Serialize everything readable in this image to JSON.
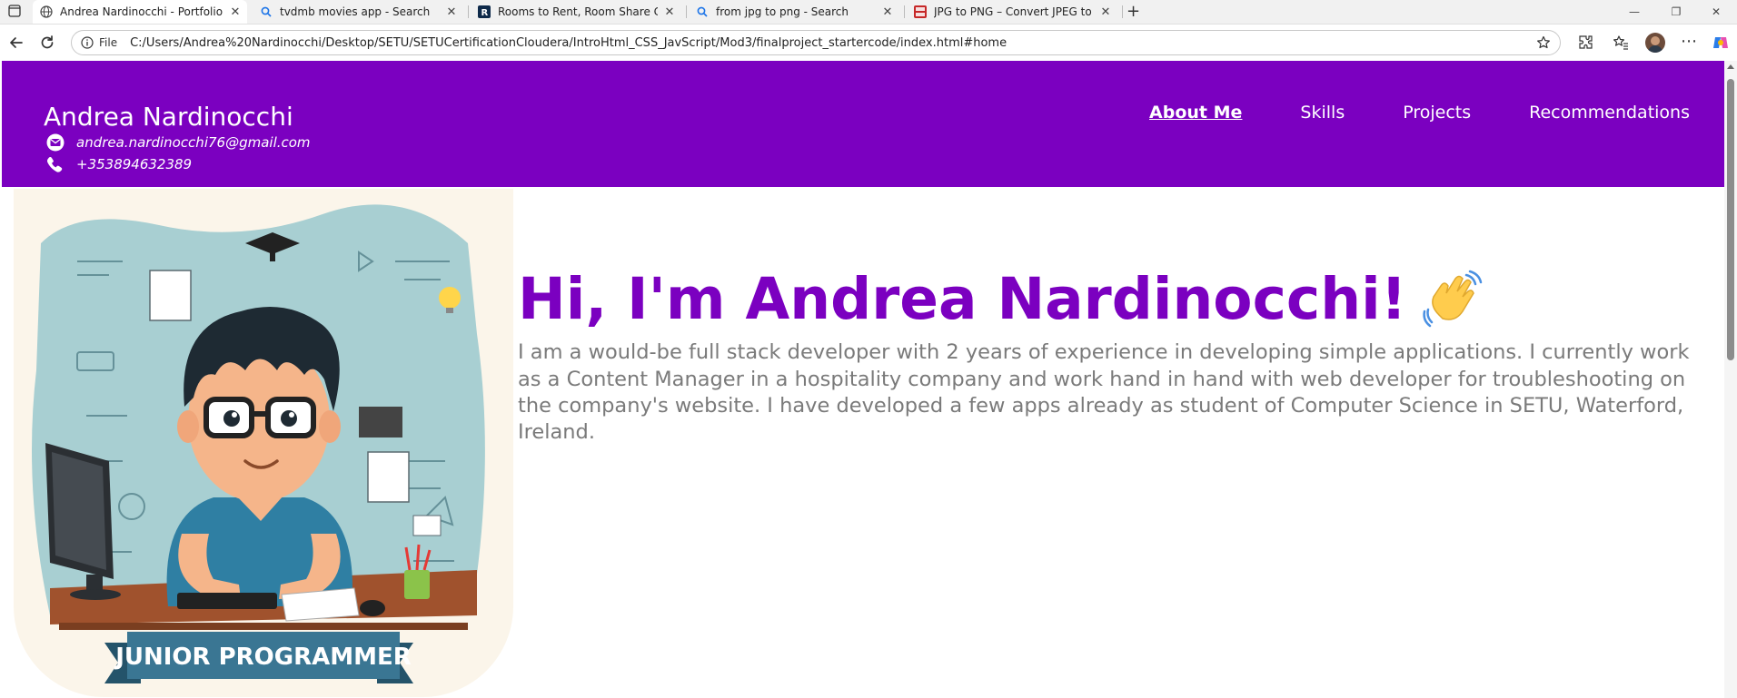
{
  "browser": {
    "tabs": [
      {
        "title": "Andrea Nardinocchi - Portfolio",
        "favicon": "globe-icon"
      },
      {
        "title": "tvdmb movies app - Search",
        "favicon": "search-icon"
      },
      {
        "title": "Rooms to Rent, Room Share Cork",
        "favicon": "r-logo-icon"
      },
      {
        "title": "from jpg to png - Search",
        "favicon": "search-icon"
      },
      {
        "title": "JPG to PNG – Convert JPEG to PN",
        "favicon": "jpg-png-icon"
      }
    ],
    "address": {
      "scheme": "File",
      "url": "C:/Users/Andrea%20Nardinocchi/Desktop/SETU/SETUCertificationCloudera/IntroHtml_CSS_JavScript/Mod3/finalproject_startercode/index.html#home"
    }
  },
  "site": {
    "name": "Andrea Nardinocchi",
    "email": "andrea.nardinocchi76@gmail.com",
    "phone": "+353894632389",
    "nav": [
      "About Me",
      "Skills",
      "Projects",
      "Recommendations"
    ],
    "active_nav": "About Me"
  },
  "hero": {
    "title": "Hi, I'm Andrea Nardinocchi!",
    "bio": "I am a would-be full stack developer with 2 years of experience in developing simple applications. I currently work as a Content Manager in a hospitality company and work hand in hand with web developer for troubleshooting on the company's website. I have developed a few apps already as student of Computer Science in SETU, Waterford, Ireland.",
    "image_banner": "JUNIOR PROGRAMMER"
  },
  "colors": {
    "brand_purple": "#7b00c0",
    "bio_gray": "#7a7a7a"
  }
}
